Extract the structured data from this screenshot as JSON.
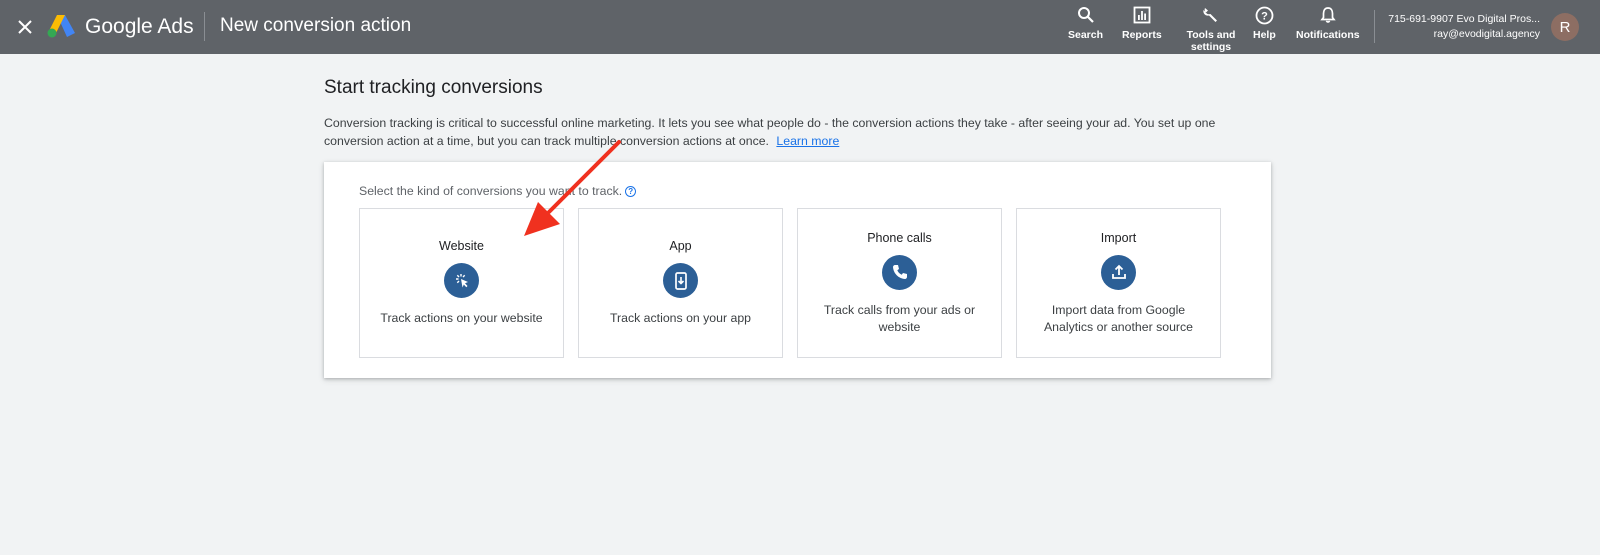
{
  "topbar": {
    "brand": "Google Ads",
    "page_heading": "New conversion action",
    "nav": {
      "search": "Search",
      "reports": "Reports",
      "tools": "Tools and\nsettings",
      "help": "Help",
      "notifications": "Notifications"
    },
    "account": {
      "name": "715-691-9907 Evo Digital Pros...",
      "email": "ray@evodigital.agency",
      "avatar_initial": "R"
    }
  },
  "main": {
    "title": "Start tracking conversions",
    "intro": "Conversion tracking is critical to successful online marketing. It lets you see what people do - the conversion actions they take - after seeing your ad. You set up one conversion action at a time, but you can track multiple conversion actions at once.",
    "learn_more": "Learn more",
    "prompt": "Select the kind of conversions you want to track.",
    "cards": [
      {
        "title": "Website",
        "description": "Track actions on your website",
        "icon": "cursor-click-icon"
      },
      {
        "title": "App",
        "description": "Track actions on your app",
        "icon": "phone-download-icon"
      },
      {
        "title": "Phone calls",
        "description": "Track calls from your ads or website",
        "icon": "phone-call-icon"
      },
      {
        "title": "Import",
        "description": "Import data from Google Analytics or another source",
        "icon": "upload-icon"
      }
    ]
  },
  "colors": {
    "topbar": "#5f6368",
    "accent": "#1a73e8",
    "icon_circle": "#2c5f96",
    "annotation_arrow": "#f0311f"
  }
}
